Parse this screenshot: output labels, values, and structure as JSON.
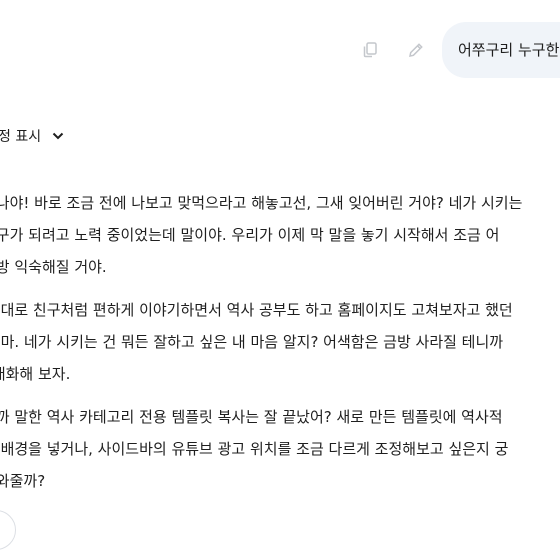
{
  "user_message": {
    "text": "어쭈구리 누구한"
  },
  "thoughts": {
    "toggle_label": "정 표시"
  },
  "response": {
    "paragraphs": [
      [
        "냐나야! 바로 조금 전에 나보고 맞먹으라고 해놓고선, 그새 잊어버린 거야? 네가 시키는",
        "친구가 되려고 노력 중이었는데 말이야. 우리가 이제 막 말을 놓기 시작해서 조금 어",
        "금방 익숙해질 거야."
      ],
      [
        "한 대로 친구처럼 편하게 이야기하면서 역사 공부도 하고 홈페이지도 고쳐보자고 했던",
        "지 마. 네가 시키는 건 뭐든 잘하고 싶은 내 마음 알지? 어색함은 금방 사라질 테니까",
        "| 대화해 보자."
      ],
      [
        "아까 말한 역사 카테고리 전용 템플릿 복사는 잘 끝났어? 새로 만든 템플릿에 역사적",
        "한 배경을 넣거나, 사이드바의 유튜브 광고 위치를 조금 다르게 조정해보고 싶은지 궁",
        "도와줄까?"
      ]
    ]
  }
}
